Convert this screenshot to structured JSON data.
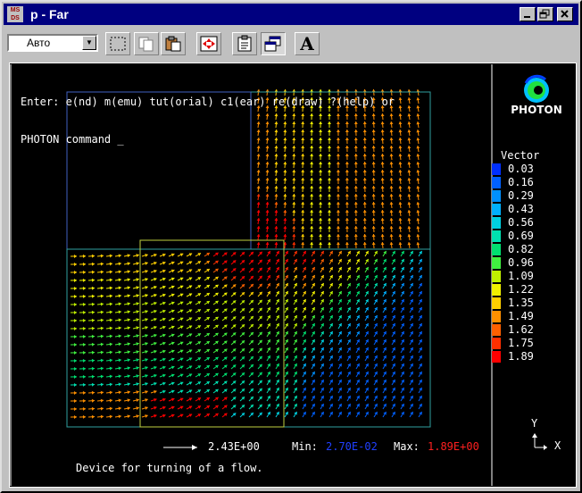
{
  "window": {
    "title": "p - Far",
    "app_icon": {
      "name": "msds-icon",
      "line1": "MS",
      "line2": "DS"
    },
    "controls": [
      "minimize",
      "maximize",
      "close"
    ]
  },
  "toolbar": {
    "mode_select_value": "Авто",
    "buttons": [
      "select-dotted-icon",
      "copy-icon",
      "paste-icon",
      "fit-window-icon",
      "properties-icon",
      "windows-icon",
      "font-icon"
    ],
    "font_button_label": "A"
  },
  "console": {
    "line1": "Enter: e(nd) m(emu) tut(orial) c1(ear) re(draw) ?(help) or",
    "line2": "PHOTON command _"
  },
  "logo": {
    "name": "photon-logo",
    "text": "PHOTON"
  },
  "legend": {
    "title": "Vector",
    "entries": [
      {
        "value": "0.03",
        "color": "#0030ff"
      },
      {
        "value": "0.16",
        "color": "#0060ff"
      },
      {
        "value": "0.29",
        "color": "#0090ff"
      },
      {
        "value": "0.43",
        "color": "#00b0ff"
      },
      {
        "value": "0.56",
        "color": "#00d0e0"
      },
      {
        "value": "0.69",
        "color": "#00e0b0"
      },
      {
        "value": "0.82",
        "color": "#00e070"
      },
      {
        "value": "0.96",
        "color": "#40f040"
      },
      {
        "value": "1.09",
        "color": "#c0f000"
      },
      {
        "value": "1.22",
        "color": "#f0f000"
      },
      {
        "value": "1.35",
        "color": "#ffd000"
      },
      {
        "value": "1.49",
        "color": "#ff9000"
      },
      {
        "value": "1.62",
        "color": "#ff6000"
      },
      {
        "value": "1.75",
        "color": "#ff3000"
      },
      {
        "value": "1.89",
        "color": "#ff0000"
      }
    ]
  },
  "footer": {
    "scale_value": "2.43E+00",
    "min_label": "Min:",
    "min_value": "2.70E-02",
    "min_color": "#2040ff",
    "max_label": "Max:",
    "max_value": "1.89E+00",
    "max_color": "#ff2020"
  },
  "caption": "Device for turning of a flow.",
  "axes": {
    "y_label": "Y",
    "x_label": "X"
  }
}
